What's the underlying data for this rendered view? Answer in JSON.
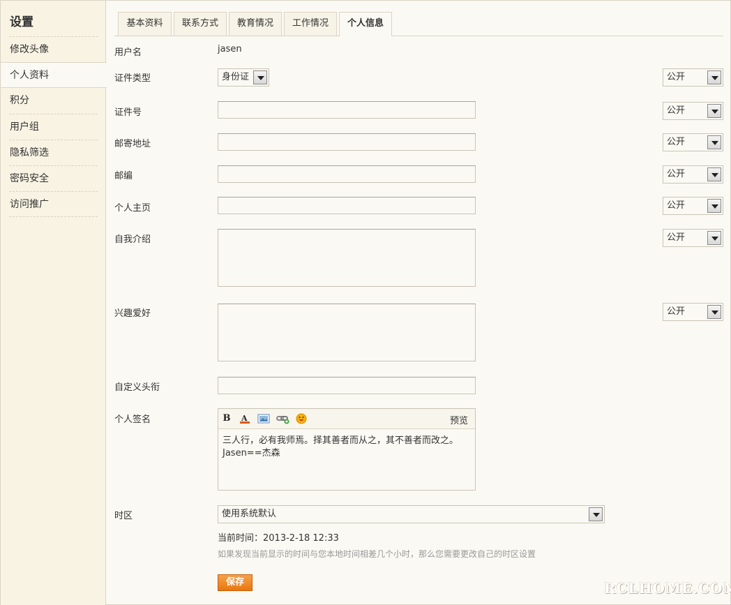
{
  "sidebar": {
    "title": "设置",
    "items": [
      {
        "label": "修改头像"
      },
      {
        "label": "个人资料"
      },
      {
        "label": "积分"
      },
      {
        "label": "用户组"
      },
      {
        "label": "隐私筛选"
      },
      {
        "label": "密码安全"
      },
      {
        "label": "访问推广"
      }
    ],
    "active_index": 1
  },
  "tabs": [
    {
      "label": "基本资料"
    },
    {
      "label": "联系方式"
    },
    {
      "label": "教育情况"
    },
    {
      "label": "工作情况"
    },
    {
      "label": "个人信息"
    }
  ],
  "active_tab": 4,
  "form": {
    "username": {
      "label": "用户名",
      "value": "jasen"
    },
    "id_type": {
      "label": "证件类型",
      "value": "身份证",
      "privacy": "公开"
    },
    "id_number": {
      "label": "证件号",
      "value": "",
      "privacy": "公开"
    },
    "address": {
      "label": "邮寄地址",
      "value": "",
      "privacy": "公开"
    },
    "zipcode": {
      "label": "邮编",
      "value": "",
      "privacy": "公开"
    },
    "homepage": {
      "label": "个人主页",
      "value": "",
      "privacy": "公开"
    },
    "bio": {
      "label": "自我介绍",
      "value": "",
      "privacy": "公开"
    },
    "interests": {
      "label": "兴趣爱好",
      "value": "",
      "privacy": "公开"
    },
    "custom_title": {
      "label": "自定义头衔",
      "value": ""
    },
    "signature": {
      "label": "个人签名",
      "preview": "预览",
      "line1": "三人行，必有我师焉。择其善者而从之，其不善者而改之。",
      "line2": "Jasen==杰森"
    },
    "timezone": {
      "label": "时区",
      "value": "使用系统默认",
      "current_time": "当前时间：2013-2-18 12:33",
      "hint": "如果发现当前显示的时间与您本地时间相差几个小时，那么您需要更改自己的时区设置"
    },
    "save_label": "保存"
  },
  "watermark": "RCLHOME.COM"
}
